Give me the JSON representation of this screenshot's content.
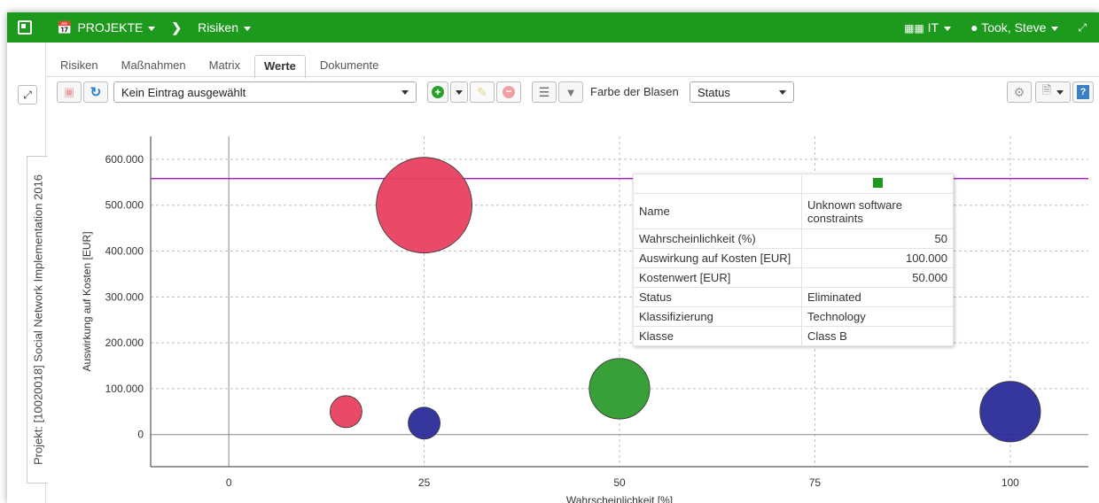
{
  "topbar": {
    "projects_label": "PROJEKTE",
    "section_label": "Risiken",
    "workspace_label": "IT",
    "user_label": "Took, Steve"
  },
  "side_tab_label": "Projekt: [10020018] Social Network Implementation 2016",
  "tabs": [
    "Risiken",
    "Maßnahmen",
    "Matrix",
    "Werte",
    "Dokumente"
  ],
  "active_tab": "Werte",
  "toolbar": {
    "entry_select_value": "Kein Eintrag ausgewählt",
    "bubble_color_label": "Farbe der Blasen",
    "bubble_color_value": "Status"
  },
  "tooltip": {
    "color": "#1d9a1d",
    "rows": [
      {
        "label": "Name",
        "value": "Unknown software constraints"
      },
      {
        "label": "Wahrscheinlichkeit (%)",
        "value": "50"
      },
      {
        "label": "Auswirkung auf Kosten [EUR]",
        "value": "100.000"
      },
      {
        "label": "Kostenwert [EUR]",
        "value": "50.000"
      },
      {
        "label": "Status",
        "value": "Eliminated"
      },
      {
        "label": "Klassifizierung",
        "value": "Technology"
      },
      {
        "label": "Klasse",
        "value": "Class B"
      }
    ]
  },
  "chart_data": {
    "type": "scatter",
    "xlabel": "Wahrscheinlichkeit [%]",
    "ylabel": "Auswirkung auf Kosten [EUR]",
    "xlim": [
      -10,
      110
    ],
    "ylim": [
      -70000,
      650000
    ],
    "x_ticks": [
      0,
      25,
      50,
      75,
      100
    ],
    "x_tick_labels": [
      "0",
      "25",
      "50",
      "75",
      "100"
    ],
    "y_ticks": [
      0,
      100000,
      200000,
      300000,
      400000,
      500000,
      600000
    ],
    "y_tick_labels": [
      "0",
      "100.000",
      "200.000",
      "300.000",
      "400.000",
      "500.000",
      "600.000"
    ],
    "threshold_line": 558000,
    "threshold_color": "#a020c0",
    "grid": true,
    "points": [
      {
        "x": 25,
        "y": 500000,
        "size": 125000,
        "color": "#e8405f"
      },
      {
        "x": 15,
        "y": 50000,
        "size": 7500,
        "color": "#e8405f"
      },
      {
        "x": 25,
        "y": 25000,
        "size": 6250,
        "color": "#2b2b9a"
      },
      {
        "x": 50,
        "y": 100000,
        "size": 50000,
        "color": "#2e9a2e"
      },
      {
        "x": 100,
        "y": 50000,
        "size": 50000,
        "color": "#2b2b9a"
      }
    ]
  }
}
